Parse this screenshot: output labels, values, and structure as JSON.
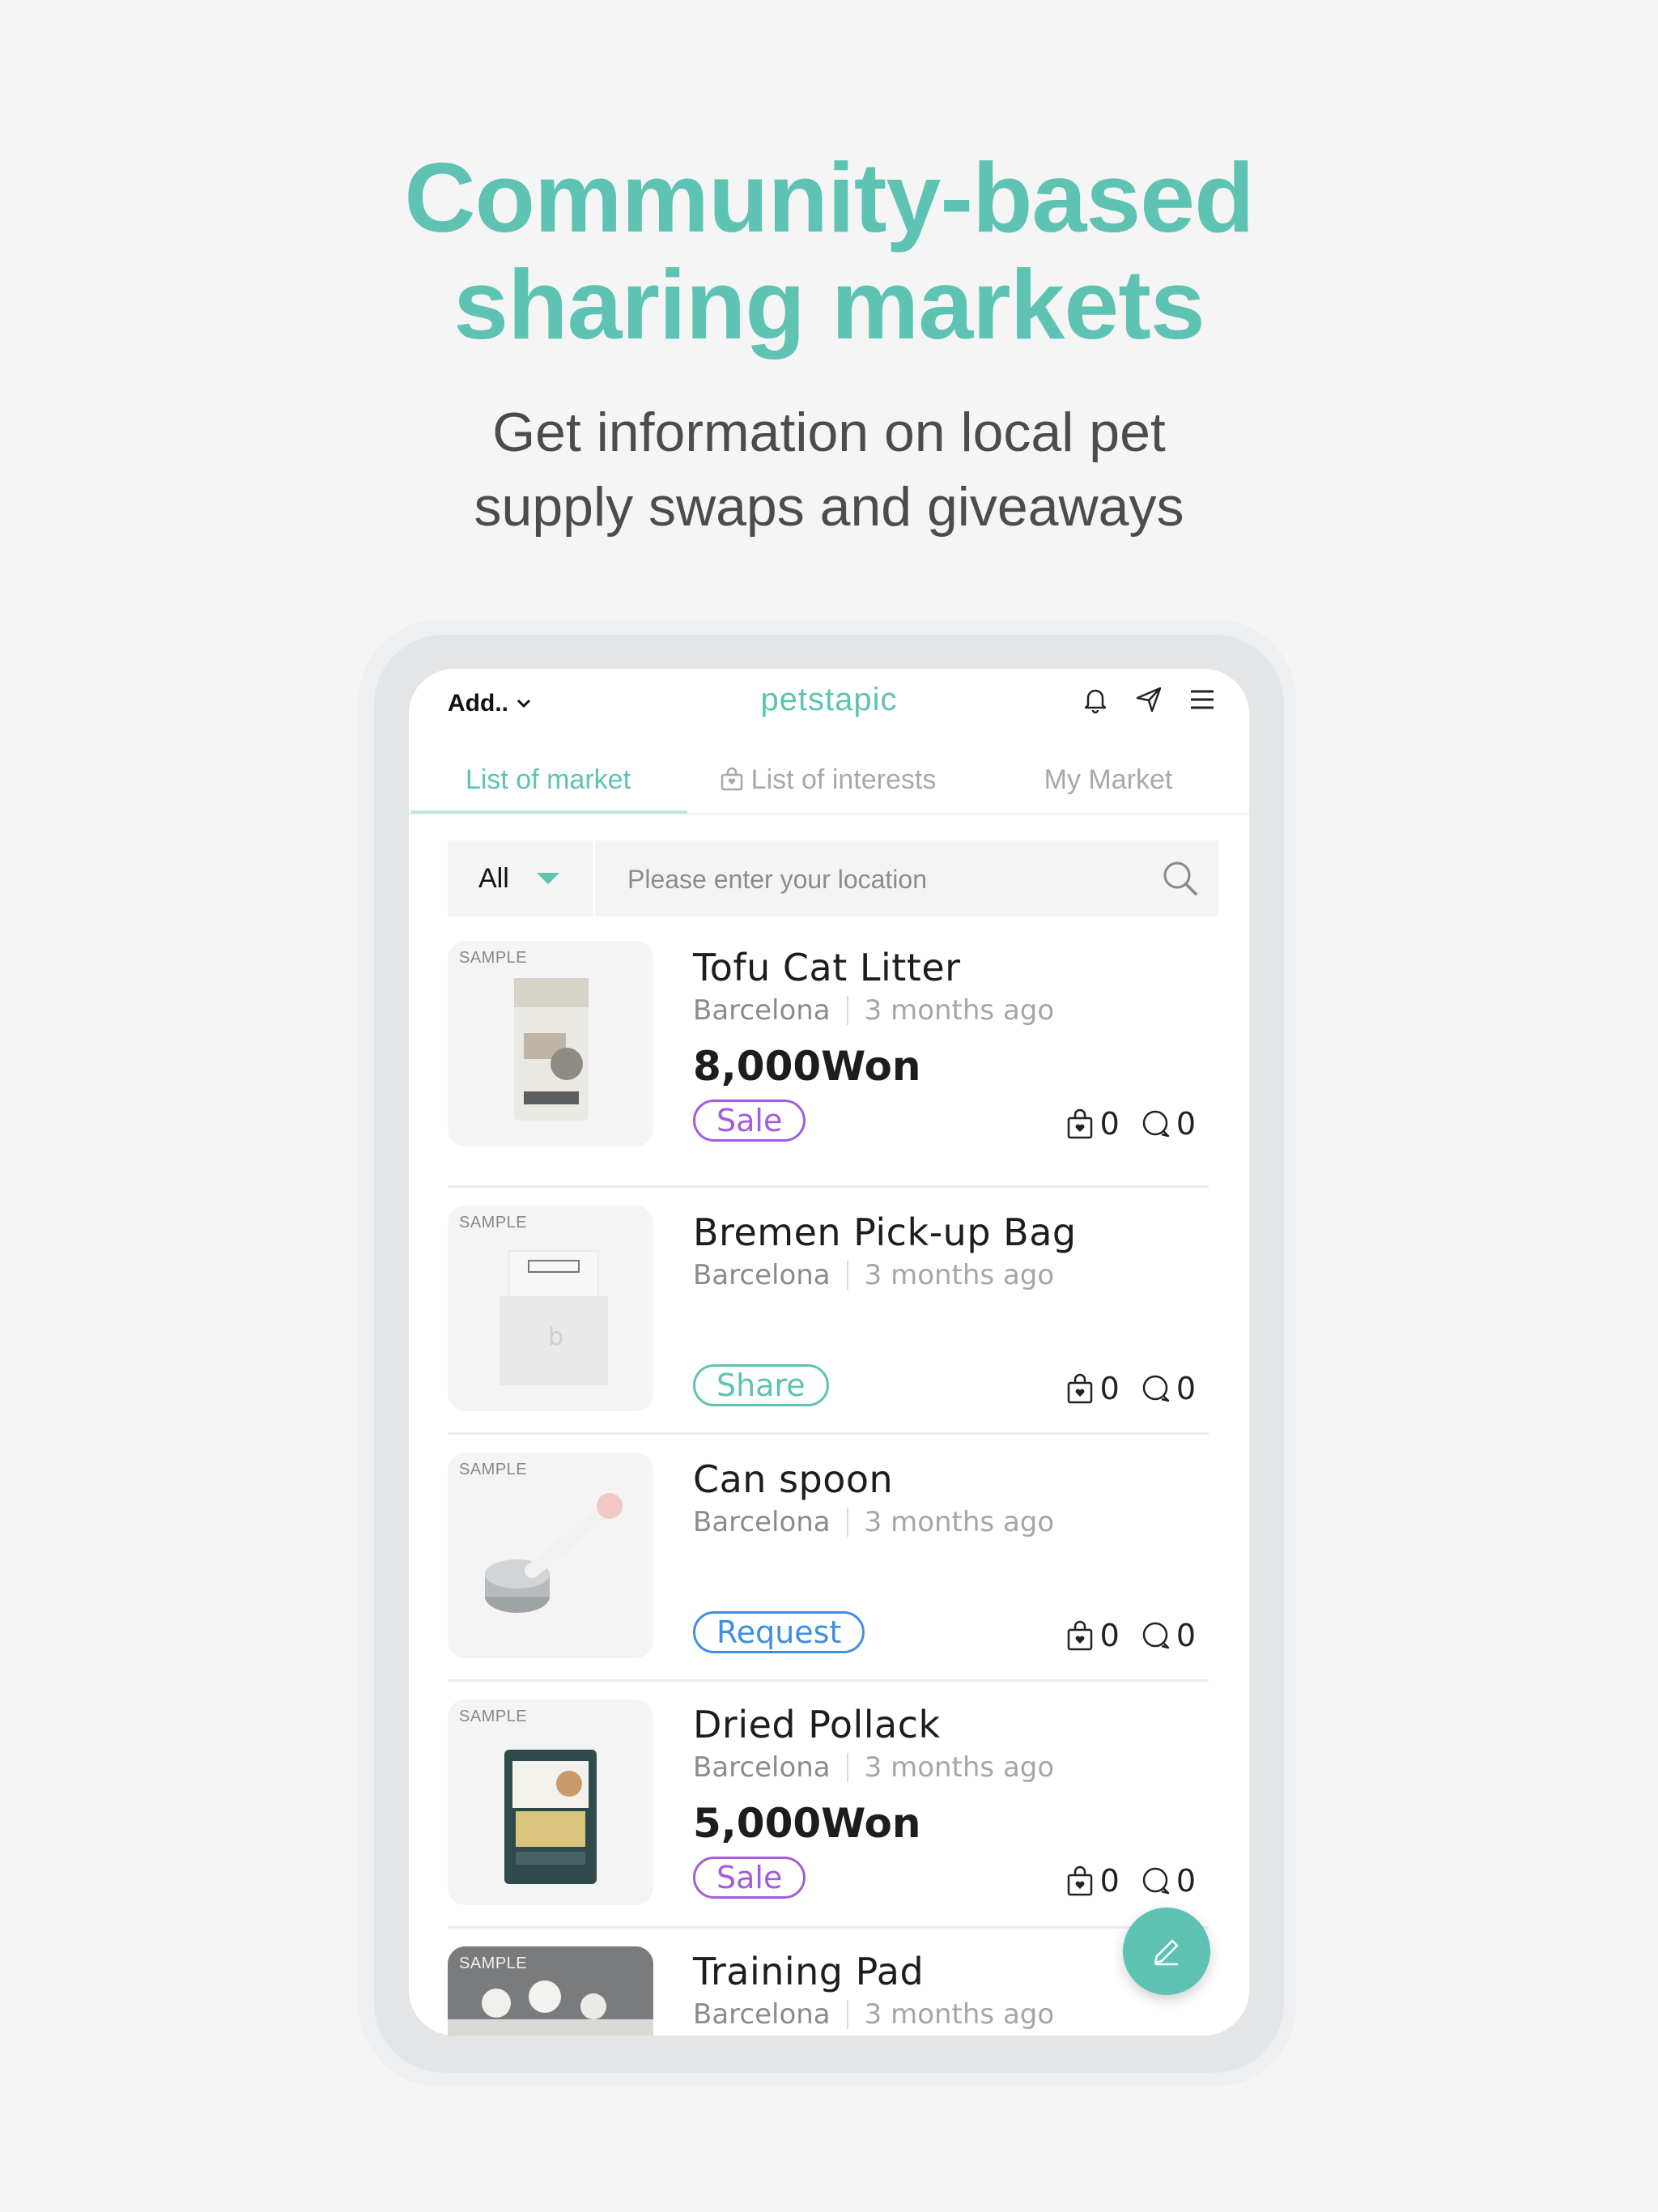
{
  "hero": {
    "title_line1": "Community-based",
    "title_line2": "sharing markets",
    "subtitle_line1": "Get information on local pet",
    "subtitle_line2": "supply swaps and giveaways"
  },
  "app": {
    "address_label": "Add..",
    "brand": "petstapic",
    "icons": [
      "bell-icon",
      "send-icon",
      "menu-icon"
    ],
    "tabs": [
      {
        "label": "List of market",
        "active": true
      },
      {
        "label": "List of interests",
        "active": false,
        "icon": "bag-icon"
      },
      {
        "label": "My Market",
        "active": false
      }
    ],
    "filter": {
      "selected": "All"
    },
    "search": {
      "placeholder": "Please enter your location"
    },
    "sample_label": "SAMPLE",
    "colors": {
      "accent": "#5ec3b3",
      "sale": "#a25ddb",
      "share": "#5ec3b3",
      "request": "#3f8fde"
    },
    "items": [
      {
        "title": "Tofu Cat Litter",
        "location": "Barcelona",
        "time": "3 months ago",
        "price": "8,000Won",
        "badge": "Sale",
        "interests": "0",
        "comments": "0"
      },
      {
        "title": "Bremen Pick-up Bag",
        "location": "Barcelona",
        "time": "3 months ago",
        "price": "",
        "badge": "Share",
        "interests": "0",
        "comments": "0"
      },
      {
        "title": "Can spoon",
        "location": "Barcelona",
        "time": "3 months ago",
        "price": "",
        "badge": "Request",
        "interests": "0",
        "comments": "0"
      },
      {
        "title": "Dried Pollack",
        "location": "Barcelona",
        "time": "3 months ago",
        "price": "5,000Won",
        "badge": "Sale",
        "interests": "0",
        "comments": "0"
      },
      {
        "title": "Training Pad",
        "location": "Barcelona",
        "time": "3 months ago",
        "price": "",
        "badge": "",
        "interests": "",
        "comments": ""
      }
    ],
    "fab_icon": "pencil-icon"
  }
}
